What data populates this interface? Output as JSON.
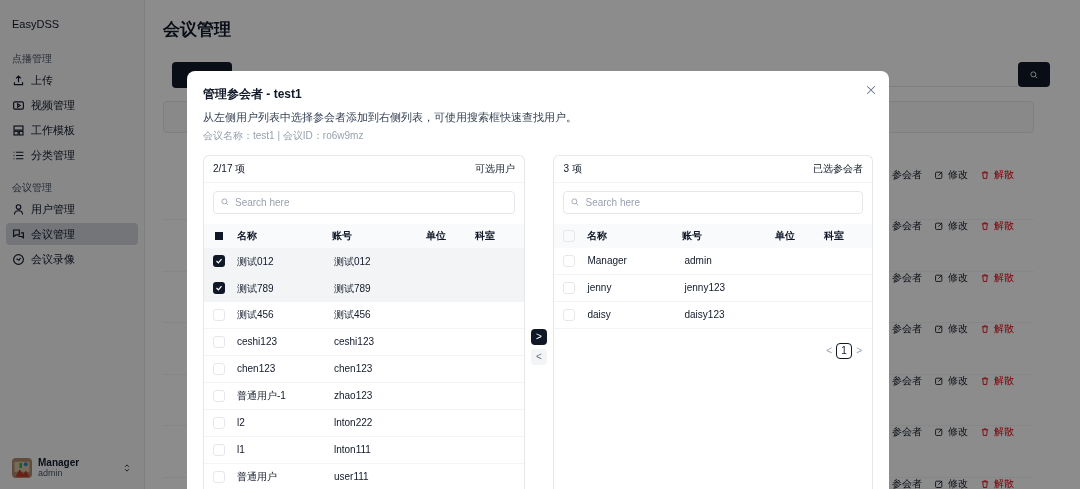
{
  "sidebar": {
    "brand": "EasyDSS",
    "groups": [
      {
        "label": "点播管理",
        "items": [
          {
            "label": "上传",
            "kind": "upload",
            "selected": false
          },
          {
            "label": "视频管理",
            "kind": "video",
            "selected": false
          },
          {
            "label": "工作模板",
            "kind": "template",
            "selected": false
          },
          {
            "label": "分类管理",
            "kind": "list",
            "selected": false
          }
        ]
      },
      {
        "label": "会议管理",
        "items": [
          {
            "label": "用户管理",
            "kind": "user",
            "selected": false
          },
          {
            "label": "会议管理",
            "kind": "meeting",
            "selected": true
          },
          {
            "label": "会议录像",
            "kind": "record",
            "selected": false
          }
        ]
      }
    ],
    "user": {
      "name": "Manager",
      "account": "admin"
    }
  },
  "page": {
    "title": "会议管理",
    "rows": [
      {
        "participants": "参会者",
        "edit": "修改",
        "dissolve": "解散"
      },
      {
        "participants": "参会者",
        "edit": "修改",
        "dissolve": "解散"
      },
      {
        "participants": "参会者",
        "edit": "修改",
        "dissolve": "解散"
      },
      {
        "participants": "参会者",
        "edit": "修改",
        "dissolve": "解散"
      },
      {
        "participants": "参会者",
        "edit": "修改",
        "dissolve": "解散"
      },
      {
        "participants": "参会者",
        "edit": "修改",
        "dissolve": "解散"
      },
      {
        "participants": "参会者",
        "edit": "修改",
        "dissolve": "解散"
      }
    ]
  },
  "dialog": {
    "title": "管理参会者 - test1",
    "description": "从左侧用户列表中选择参会者添加到右侧列表，可使用搜索框快速查找用户。",
    "meta": "会议名称：test1 | 会议ID：ro6w9mz",
    "left": {
      "count": "2/17 项",
      "caption": "可选用户",
      "placeholder": "Search here",
      "select_all_partial": true,
      "columns": [
        "名称",
        "账号",
        "单位",
        "科室"
      ],
      "rows": [
        {
          "name": "测试012",
          "account": "测试012",
          "checked": true
        },
        {
          "name": "测试789",
          "account": "测试789",
          "checked": true
        },
        {
          "name": "测试456",
          "account": "测试456",
          "checked": false
        },
        {
          "name": "ceshi123",
          "account": "ceshi123",
          "checked": false
        },
        {
          "name": "chen123",
          "account": "chen123",
          "checked": false
        },
        {
          "name": "普通用户-1",
          "account": "zhao123",
          "checked": false
        },
        {
          "name": "l2",
          "account": "lnton222",
          "checked": false
        },
        {
          "name": "l1",
          "account": "lnton111",
          "checked": false
        },
        {
          "name": "普通用户",
          "account": "user111",
          "checked": false
        }
      ]
    },
    "transfer": [
      {
        "glyph": ">",
        "disabled": false
      },
      {
        "glyph": "<",
        "disabled": true
      }
    ],
    "right": {
      "count": "3 项",
      "caption": "已选参会者",
      "placeholder": "Search here",
      "select_all_partial": false,
      "columns": [
        "名称",
        "账号",
        "单位",
        "科室"
      ],
      "rows": [
        {
          "name": "Manager",
          "account": "admin",
          "checked": false
        },
        {
          "name": "jenny",
          "account": "jenny123",
          "checked": false
        },
        {
          "name": "daisy",
          "account": "daisy123",
          "checked": false
        }
      ],
      "prev": "<",
      "next": ">",
      "pages": [
        {
          "label": "1",
          "selected": true
        }
      ]
    }
  }
}
